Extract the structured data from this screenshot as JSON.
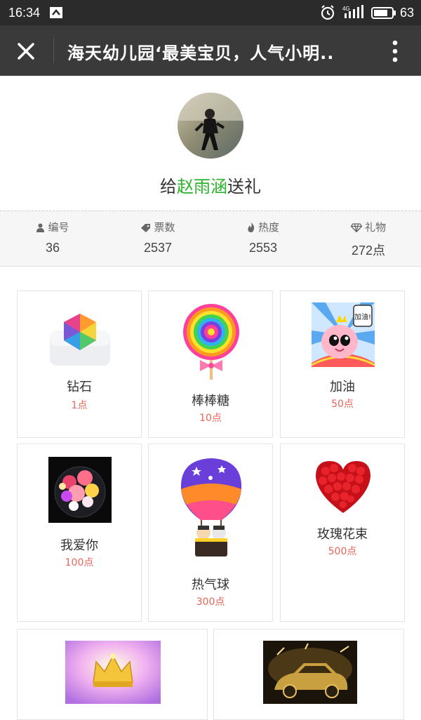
{
  "status_bar": {
    "time": "16:34",
    "network_label": "4G",
    "battery": "63"
  },
  "header": {
    "title": "海天幼儿园‘最美宝贝，人气小明..",
    "close_icon": "close-icon",
    "more_icon": "more-vertical-icon"
  },
  "profile": {
    "give_prefix": "给",
    "child_name": "赵雨涵",
    "give_suffix": "送礼",
    "name_color": "#2bb32b"
  },
  "stats": [
    {
      "icon": "person-icon",
      "label": "编号",
      "value": "36"
    },
    {
      "icon": "ticket-icon",
      "label": "票数",
      "value": "2537"
    },
    {
      "icon": "flame-icon",
      "label": "热度",
      "value": "2553"
    },
    {
      "icon": "diamond-icon",
      "label": "礼物",
      "value": "272点"
    }
  ],
  "gifts": [
    {
      "name": "钻石",
      "price": "1点",
      "icon": "diamond-gift-icon"
    },
    {
      "name": "棒棒糖",
      "price": "10点",
      "icon": "lollipop-icon"
    },
    {
      "name": "加油",
      "price": "50点",
      "icon": "cheer-icon",
      "image_text": "加油!"
    },
    {
      "name": "我爱你",
      "price": "100点",
      "icon": "flower-box-icon"
    },
    {
      "name": "热气球",
      "price": "300点",
      "icon": "hot-air-balloon-icon"
    },
    {
      "name": "玫瑰花束",
      "price": "500点",
      "icon": "rose-heart-icon"
    },
    {
      "name": "",
      "price": "",
      "icon": "crown-icon"
    },
    {
      "name": "",
      "price": "",
      "icon": "gold-car-icon"
    }
  ],
  "colors": {
    "price": "#e8655a",
    "header_bg": "#3a3a3a",
    "status_bg": "#2b2b2b"
  }
}
